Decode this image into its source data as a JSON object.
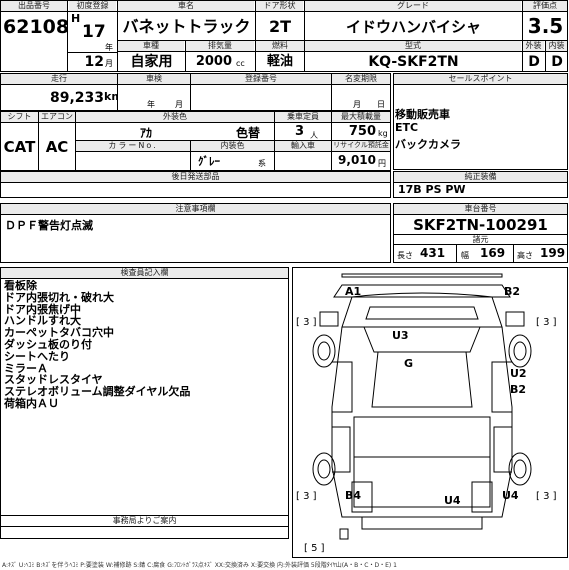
{
  "header": {
    "lot_label": "出品番号",
    "first_reg_label": "初度登録",
    "name_label": "車名",
    "door_label": "ドア形状",
    "grade_label": "グレード",
    "score_label": "評価点",
    "lot_no": "62108",
    "era": "H",
    "year": "17",
    "year_unit": "年",
    "car_name": "バネットトラック",
    "doors": "2T",
    "grade": "イドウハンバイシャ",
    "score": "3.5",
    "month": "12",
    "month_unit": "月",
    "body_type_label": "車種",
    "displacement_label": "排気量",
    "fuel_label": "燃料",
    "model_label": "型式",
    "ext_label": "外装",
    "int_label": "内装",
    "use_type": "自家用",
    "displacement": "2000",
    "cc": "cc",
    "fuel": "軽油",
    "model_code": "KQ-SKF2TN",
    "ext_grade": "D",
    "int_grade": "D"
  },
  "row2": {
    "mileage_label": "走行",
    "inspection_label": "車検",
    "reg_no_label": "登録番号",
    "name_change_label": "名変期限",
    "sales_point_label": "セールスポイント",
    "mileage": "89,233",
    "km": "km",
    "y": "年",
    "m": "月",
    "m2": "月",
    "d": "日"
  },
  "row3": {
    "shift_label": "シフト",
    "ac_label": "エアコン",
    "ext_color_label": "外装色",
    "capacity_label": "乗車定員",
    "max_load_label": "最大積載量",
    "color_name": "ｱｶ",
    "color_change": "色替",
    "capacity": "3",
    "person_unit": "人",
    "max_load": "750",
    "kg": "kg",
    "shift": "CAT",
    "ac": "AC",
    "color_no_label": "カラーNo.",
    "int_color_label": "内装色",
    "import_label": "輸入車",
    "recycle_label": "リサイクル預託金",
    "int_color": "ｸﾞﾚｰ",
    "kei": "系",
    "recycle": "9,010",
    "yen": "円",
    "sales_points": [
      "移動販売車",
      "ETC",
      "バックカメラ"
    ]
  },
  "delivery_label": "後日発送部品",
  "notes_label": "注意事項欄",
  "notes": "ＤＰＦ警告灯点滅",
  "equip_label": "純正装備",
  "equipment": "17B PS PW",
  "chassis_label": "車台番号",
  "chassis_no": "SKF2TN-100291",
  "dims_label": "諸元",
  "dims": {
    "l_label": "長さ",
    "l": "431",
    "w_label": "幅",
    "w": "169",
    "h_label": "高さ",
    "h": "199"
  },
  "inspector_label": "検査員記入欄",
  "inspector_notes": [
    "看板除",
    "ドア内張切れ・破れ大",
    "ドア内張焦げ中",
    "ハンドルすれ大",
    "カーペットタバコ穴中",
    "ダッシュ板のり付",
    "シートへたり",
    "ミラーＡ",
    "スタッドレスタイヤ",
    "ステレオボリューム調整ダイヤル欠品",
    "荷箱内ＡＵ"
  ],
  "office_label": "事務局よりご案内",
  "diagram": {
    "marks": [
      "A1",
      "B2",
      "U3",
      "G",
      "U2",
      "B2",
      "B4",
      "U4",
      "U4"
    ],
    "tires": [
      "[ 3 ]",
      "[ 3 ]",
      "[ 3 ]",
      "[ 3 ]",
      "[ 5 ]"
    ]
  },
  "legend": "A:ｷｽﾞ U:ﾍｺﾐ B:ｷｽﾞを伴うﾍｺﾐ P:要塗装 W:補修跡 S:錆 C:腐食 G:ﾌﾛﾝﾄｶﾞﾗｽ点ｷｽﾞ XX:交換済み X:要交換 内:外装評価 5段階ﾀｲﾔ山(A・B・C・D・E) 1"
}
